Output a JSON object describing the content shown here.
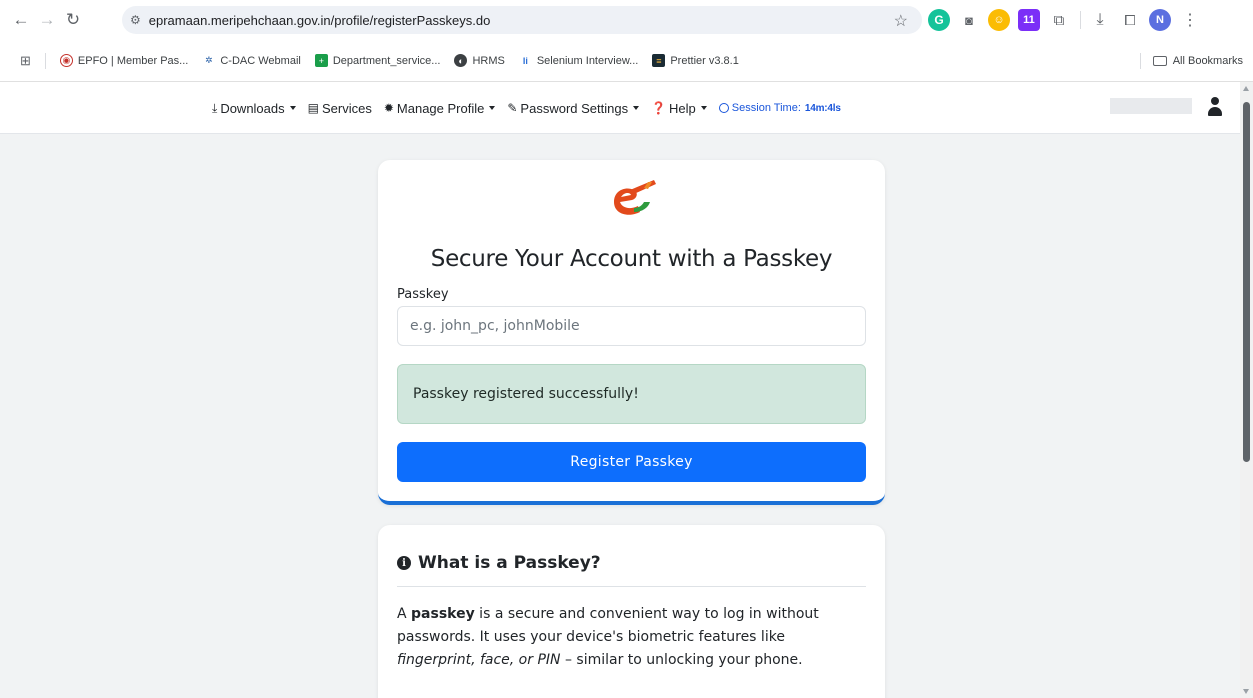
{
  "browser": {
    "url": "epramaan.meripehchaan.gov.in/profile/registerPasskeys.do",
    "avatar_letter": "N",
    "bookmarks": [
      {
        "label": "EPFO | Member Pas...",
        "icon": "epfo-icon"
      },
      {
        "label": "C-DAC Webmail",
        "icon": "cdac-icon"
      },
      {
        "label": "Department_service...",
        "icon": "department-icon"
      },
      {
        "label": "HRMS",
        "icon": "hrms-icon"
      },
      {
        "label": "Selenium Interview...",
        "icon": "selenium-icon"
      },
      {
        "label": "Prettier v3.8.1",
        "icon": "prettier-icon"
      }
    ],
    "all_bookmarks": "All Bookmarks"
  },
  "nav": {
    "downloads": "Downloads",
    "services": "Services",
    "manage_profile": "Manage Profile",
    "password_settings": "Password Settings",
    "help": "Help",
    "session_label": "Session Time:",
    "session_value": "14m:4ls"
  },
  "main": {
    "title": "Secure Your Account with a Passkey",
    "passkey_label": "Passkey",
    "passkey_placeholder": "e.g. john_pc, johnMobile",
    "passkey_value": "",
    "alert": "Passkey registered successfully!",
    "register_button": "Register Passkey"
  },
  "info": {
    "heading": "What is a Passkey?",
    "p_start": "A ",
    "p_bold": "passkey",
    "p_mid": " is a secure and convenient way to log in without passwords. It uses your device's biometric features like ",
    "p_italic": "fingerprint, face, or PIN",
    "p_end": " – similar to unlocking your phone."
  },
  "colors": {
    "primary": "#0d6efd",
    "success_bg": "#d1e7dd",
    "session": "#1a56db"
  }
}
